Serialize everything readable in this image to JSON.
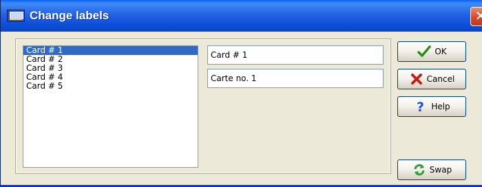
{
  "window": {
    "title": "Change labels",
    "close_glyph": "✕"
  },
  "cards": {
    "items": [
      "Card # 1",
      "Card # 2",
      "Card # 3",
      "Card # 4",
      "Card # 5"
    ],
    "selected_index": 0
  },
  "fields": {
    "label1_value": "Card # 1",
    "label2_value": "Carte no. 1"
  },
  "buttons": {
    "ok_label": "OK",
    "cancel_label": "Cancel",
    "help_label": "Help",
    "swap_label": "Swap"
  },
  "icons": {
    "app": "app-screen-icon",
    "ok": "checkmark-icon",
    "cancel": "red-x-icon",
    "help": "question-mark-icon",
    "swap": "swap-arrows-icon"
  },
  "colors": {
    "selection": "#316AC5",
    "ok_green": "#2E8B1F",
    "cancel_red": "#C0201A",
    "help_blue": "#1E4FD0",
    "swap_green": "#2F9E3A"
  }
}
